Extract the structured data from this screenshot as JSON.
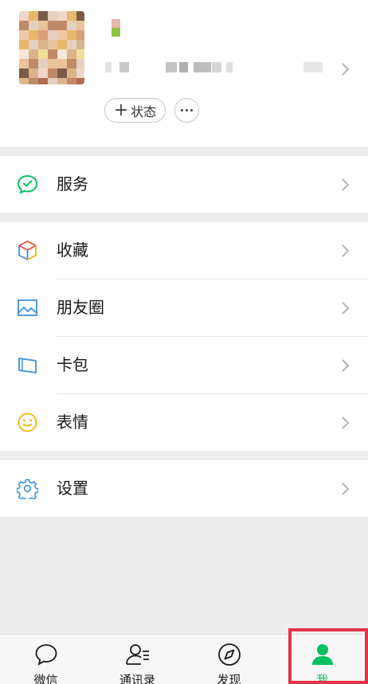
{
  "colors": {
    "accent": "#07c160",
    "highlight": "#e5334a",
    "background": "#ededed"
  },
  "profile": {
    "status_label": "状态",
    "status_icon": "plus-icon",
    "more_icon": "more-dots-icon"
  },
  "menu": {
    "services": {
      "label": "服务",
      "icon": "wechat-pay-icon"
    },
    "favorites": {
      "label": "收藏",
      "icon": "cube-icon"
    },
    "moments": {
      "label": "朋友圈",
      "icon": "image-icon"
    },
    "cards": {
      "label": "卡包",
      "icon": "card-icon"
    },
    "stickers": {
      "label": "表情",
      "icon": "smiley-icon"
    },
    "settings": {
      "label": "设置",
      "icon": "gear-icon"
    }
  },
  "tabs": [
    {
      "label": "微信",
      "icon": "chat-bubble-icon",
      "active": false
    },
    {
      "label": "通讯录",
      "icon": "contacts-icon",
      "active": false
    },
    {
      "label": "发现",
      "icon": "compass-icon",
      "active": false
    },
    {
      "label": "我",
      "icon": "person-icon",
      "active": true
    }
  ]
}
